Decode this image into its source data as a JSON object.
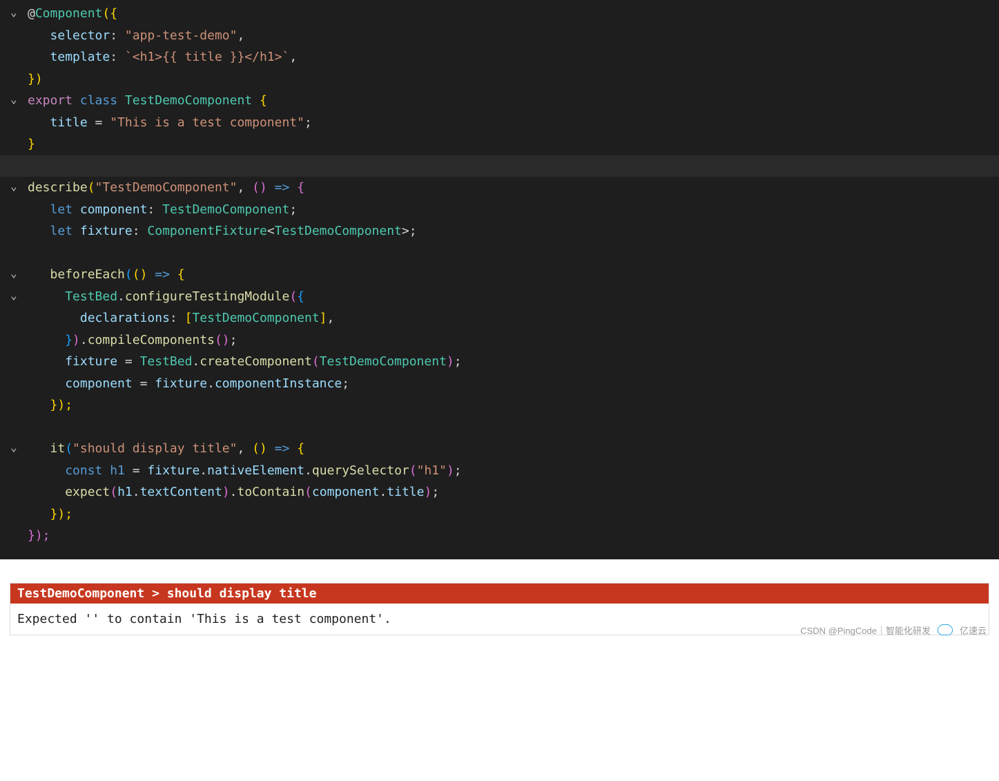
{
  "colors": {
    "editor_bg": "#1e1e1e",
    "error_bg": "#c7371f",
    "type": "#4ec9b0",
    "keyword": "#569cd6",
    "export": "#c586c0",
    "prop": "#9cdcfe",
    "string": "#ce9178",
    "func": "#dcdcaa"
  },
  "code": {
    "l1": {
      "at": "@",
      "component": "Component",
      "open": "({"
    },
    "l2": {
      "prop": "selector",
      "colon": ": ",
      "val": "\"app-test-demo\"",
      "comma": ","
    },
    "l3": {
      "prop": "template",
      "colon": ": ",
      "val": "`<h1>{{ title }}</h1>`",
      "comma": ","
    },
    "l4": {
      "close": "})"
    },
    "l5": {
      "export": "export",
      "class": "class",
      "name": "TestDemoComponent",
      "brace": " {"
    },
    "l6": {
      "prop": "title",
      "eq": " = ",
      "val": "\"This is a test component\"",
      "semi": ";"
    },
    "l7": {
      "brace": "}"
    },
    "l8": {},
    "l9": {
      "fn": "describe",
      "open": "(",
      "str": "\"TestDemoComponent\"",
      "comma": ", ",
      "paren2o": "(",
      "paren2c": ")",
      "arrow": " => ",
      "brace": "{"
    },
    "l10": {
      "let": "let",
      "name": "component",
      "colon": ": ",
      "type": "TestDemoComponent",
      "semi": ";"
    },
    "l11": {
      "let": "let",
      "name": "fixture",
      "colon": ": ",
      "type": "ComponentFixture",
      "lt": "<",
      "gentype": "TestDemoComponent",
      "gt": ">",
      "semi": ";"
    },
    "l13": {
      "fn": "beforeEach",
      "open": "(",
      "paren2o": "(",
      "paren2c": ")",
      "arrow": " => ",
      "brace": "{"
    },
    "l14": {
      "obj": "TestBed",
      "dot": ".",
      "fn": "configureTestingModule",
      "open": "(",
      "brace": "{"
    },
    "l15": {
      "prop": "declarations",
      "colon": ": ",
      "brko": "[",
      "type": "TestDemoComponent",
      "brkc": "]",
      "comma": ","
    },
    "l16": {
      "braceclose": "}",
      "close": ")",
      "dot": ".",
      "fn": "compileComponents",
      "open2": "(",
      "close2": ")",
      "semi": ";"
    },
    "l17": {
      "lhs": "fixture",
      "eq": " = ",
      "obj": "TestBed",
      "dot": ".",
      "fn": "createComponent",
      "open": "(",
      "type": "TestDemoComponent",
      "close": ")",
      "semi": ";"
    },
    "l18": {
      "lhs": "component",
      "eq": " = ",
      "obj": "fixture",
      "dot": ".",
      "prop": "componentInstance",
      "semi": ";"
    },
    "l19": {
      "close": "});"
    },
    "l21": {
      "fn": "it",
      "open": "(",
      "str": "\"should display title\"",
      "comma": ", ",
      "paren2o": "(",
      "paren2c": ")",
      "arrow": " => ",
      "brace": "{"
    },
    "l22": {
      "const": "const",
      "name": "h1",
      "eq": " = ",
      "obj": "fixture",
      "dot": ".",
      "prop1": "nativeElement",
      "dot2": ".",
      "fn": "querySelector",
      "open": "(",
      "str": "\"h1\"",
      "close": ")",
      "semi": ";"
    },
    "l23": {
      "fn": "expect",
      "open": "(",
      "obj": "h1",
      "dot": ".",
      "prop": "textContent",
      "close": ")",
      "dot2": ".",
      "fn2": "toContain",
      "open2": "(",
      "obj2": "component",
      "dot3": ".",
      "prop2": "title",
      "close2": ")",
      "semi": ";"
    },
    "l24": {
      "close": "});"
    },
    "l25": {
      "close": "});"
    }
  },
  "result": {
    "header": "TestDemoComponent > should display title",
    "body": "Expected '' to contain 'This is a test component'."
  },
  "watermark": {
    "left": "CSDN @PingCode｜智能化研发",
    "right": "亿速云"
  }
}
